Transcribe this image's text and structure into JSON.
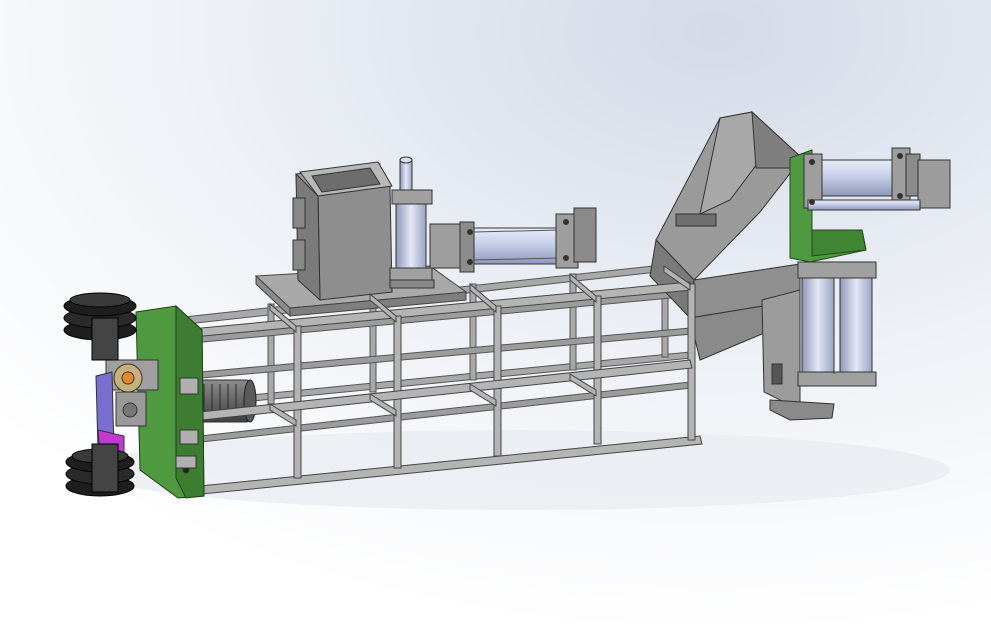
{
  "colors": {
    "background_top": "#dfe4ee",
    "background_bottom": "#ffffff",
    "steel": "#9a9a9a",
    "steel_dark": "#6f6f6f",
    "steel_light": "#c4c4c4",
    "green_plate": "#4f9a40",
    "cylinder_blue": "#c6cee8",
    "rubber_black": "#1e1e1e",
    "accent_magenta": "#c23ad4",
    "accent_orange": "#e58a2a"
  }
}
